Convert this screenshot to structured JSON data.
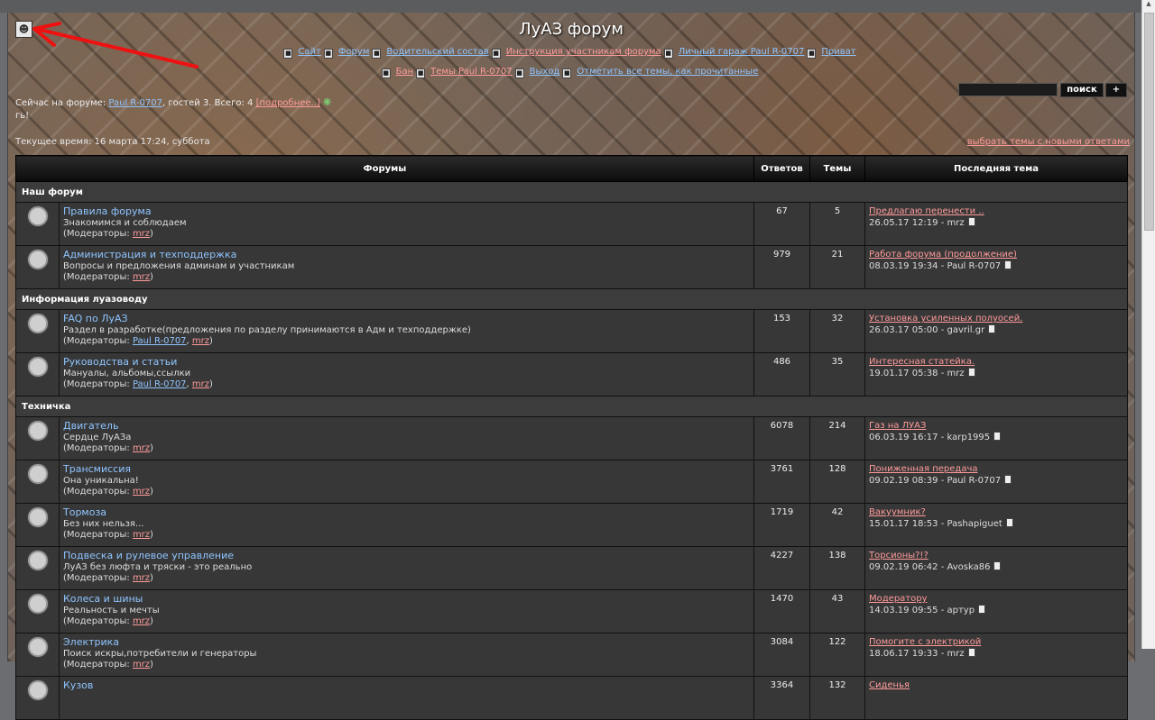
{
  "header": {
    "title": "ЛуАЗ форум",
    "nav_row1": [
      {
        "label": "Сайт",
        "color": "blue"
      },
      {
        "label": "Форум",
        "color": "blue"
      },
      {
        "label": "Водительский состав",
        "color": "blue"
      },
      {
        "label": "Инструкция участникам форума",
        "color": "pink"
      },
      {
        "label": "Личный гараж Paul R-0707",
        "color": "blue"
      },
      {
        "label": "Приват",
        "color": "blue"
      }
    ],
    "nav_row2": [
      {
        "label": "Бан",
        "color": "pink"
      },
      {
        "label": "Темы Paul R-0707",
        "color": "pink"
      },
      {
        "label": "Выход",
        "color": "blue"
      },
      {
        "label": "Отметить все темы, как прочитанные",
        "color": "blue"
      }
    ]
  },
  "online": {
    "prefix": "Сейчас на форуме:",
    "user": "Paul R-0707",
    "guests": ", гостей 3. Всего: 4",
    "more": "[подробнее..]",
    "line2": "гь!"
  },
  "search": {
    "button": "поиск",
    "plus": "+"
  },
  "current_time": "Текущее время: 16 марта 17:24, суббота",
  "new_topics_link": "выбрать темы с новыми ответами",
  "table": {
    "headers": {
      "forums": "Форумы",
      "replies": "Ответов",
      "topics": "Темы",
      "last": "Последняя тема"
    },
    "mods_label": "(Модераторы:",
    "sections": [
      {
        "title": "Наш форум",
        "forums": [
          {
            "name": "Правила форума",
            "desc": "Знакомимся и соблюдаем",
            "mods": [
              "mrz"
            ],
            "replies": "67",
            "topics": "5",
            "last_title": "Предлагаю перенести ..",
            "last_meta": "26.05.17 12:19 - mrz"
          },
          {
            "name": "Администрация и техподдержка",
            "desc": "Вопросы и предложения админам и участникам",
            "mods": [
              "mrz"
            ],
            "replies": "979",
            "topics": "21",
            "last_title": "Работа форума (продолжение)",
            "last_meta": "08.03.19 19:34 - Paul R-0707"
          }
        ]
      },
      {
        "title": "Информация луазоводу",
        "forums": [
          {
            "name": "FAQ по ЛуАЗ",
            "desc": "Раздел в разработке(предложения по разделу принимаются в Адм и техподдержке)",
            "mods": [
              "Paul R-0707",
              "mrz"
            ],
            "replies": "153",
            "topics": "32",
            "last_title": "Установка усиленных полуосей.",
            "last_meta": "26.03.17 05:00 - gavril.gr"
          },
          {
            "name": "Руководства и статьи",
            "desc": "Мануалы, альбомы,ссылки",
            "mods": [
              "Paul R-0707",
              "mrz"
            ],
            "replies": "486",
            "topics": "35",
            "last_title": "Интересная статейка.",
            "last_meta": "19.01.17 05:38 - mrz"
          }
        ]
      },
      {
        "title": "Техничка",
        "forums": [
          {
            "name": "Двигатель",
            "desc": "Сердце ЛуАЗа",
            "mods": [
              "mrz"
            ],
            "replies": "6078",
            "topics": "214",
            "last_title": "Газ на ЛУАЗ",
            "last_meta": "06.03.19 16:17 - karp1995"
          },
          {
            "name": "Трансмиссия",
            "desc": "Она уникальна!",
            "mods": [
              "mrz"
            ],
            "replies": "3761",
            "topics": "128",
            "last_title": "Пониженная передача",
            "last_meta": "09.02.19 08:39 - Paul R-0707"
          },
          {
            "name": "Тормоза",
            "desc": "Без них нельзя...",
            "mods": [
              "mrz"
            ],
            "replies": "1719",
            "topics": "42",
            "last_title": "Вакуумник?",
            "last_meta": "15.01.17 18:53 - Pashapiguet"
          },
          {
            "name": "Подвеска и рулевое управление",
            "desc": "ЛуАЗ без люфта и тряски - это реально",
            "mods": [
              "mrz"
            ],
            "replies": "4227",
            "topics": "138",
            "last_title": "Торсионы?!?",
            "last_meta": "09.02.19 06:42 - Avoska86"
          },
          {
            "name": "Колеса и шины",
            "desc": "Реальность и мечты",
            "mods": [
              "mrz"
            ],
            "replies": "1470",
            "topics": "43",
            "last_title": "Модератору",
            "last_meta": "14.03.19 09:55 - артур"
          },
          {
            "name": "Электрика",
            "desc": "Поиск искры,потребители и генераторы",
            "mods": [
              "mrz"
            ],
            "replies": "3084",
            "topics": "122",
            "last_title": "Помогите с электрикой",
            "last_meta": "18.06.17 19:33 - mrz"
          },
          {
            "name": "Кузов",
            "desc": "",
            "mods": [],
            "replies": "3364",
            "topics": "132",
            "last_title": "Сиденья",
            "last_meta": ""
          }
        ]
      }
    ]
  },
  "colors": {
    "link_blue": "#8fc5ff",
    "link_pink": "#ff9b9b",
    "row_bg": "#373737",
    "header_bg": "#0c0c0c"
  }
}
